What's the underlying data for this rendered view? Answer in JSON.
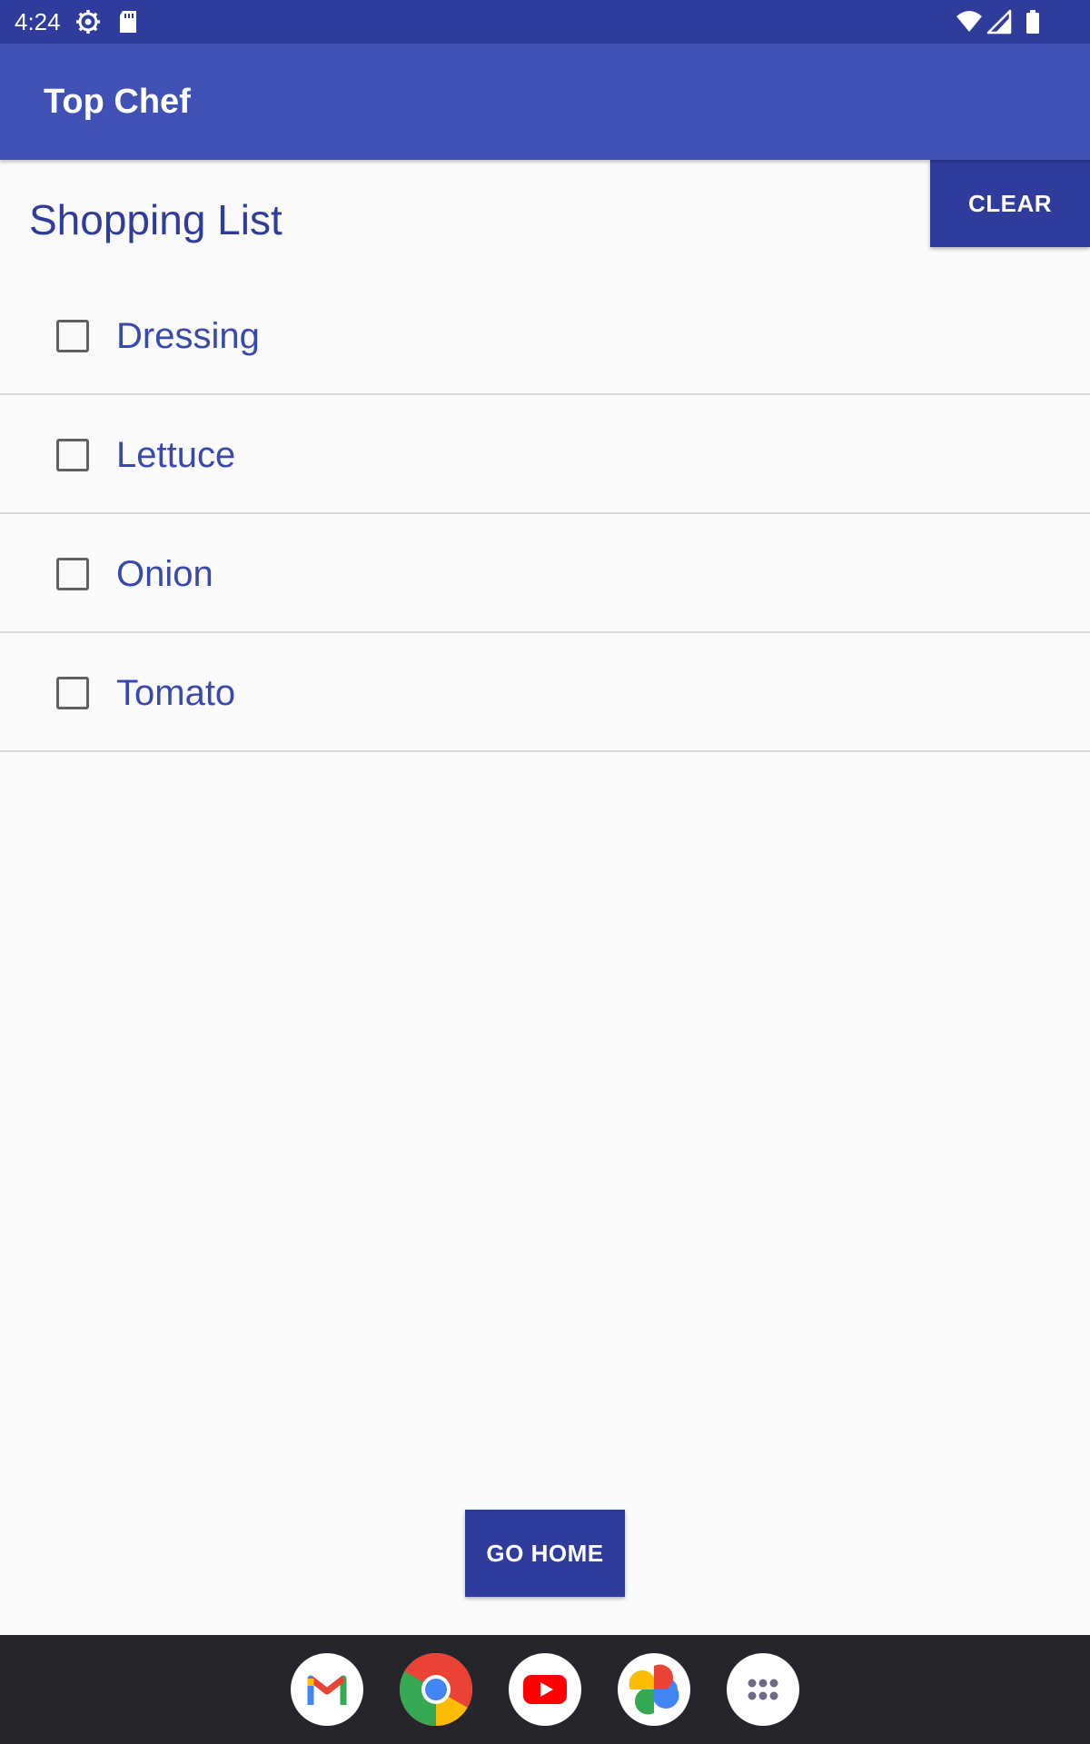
{
  "status_bar": {
    "time": "4:24",
    "icons": [
      "settings-gear-icon",
      "sd-card-icon",
      "wifi-icon",
      "cell-signal-icon",
      "battery-icon"
    ]
  },
  "app_bar": {
    "title": "Top Chef"
  },
  "main": {
    "title": "Shopping List",
    "clear_label": "CLEAR",
    "items": [
      {
        "label": "Dressing",
        "checked": false
      },
      {
        "label": "Lettuce",
        "checked": false
      },
      {
        "label": "Onion",
        "checked": false
      },
      {
        "label": "Tomato",
        "checked": false
      }
    ],
    "go_home_label": "GO HOME"
  },
  "dock": {
    "apps": [
      "gmail-icon",
      "chrome-icon",
      "youtube-icon",
      "photos-icon",
      "app-drawer-icon"
    ]
  },
  "colors": {
    "status_bar": "#2f3c9c",
    "app_bar": "#3f51b5",
    "button": "#2f3c9c",
    "item_text": "#3949ab",
    "background": "#fafafa",
    "dock": "#26252c"
  }
}
